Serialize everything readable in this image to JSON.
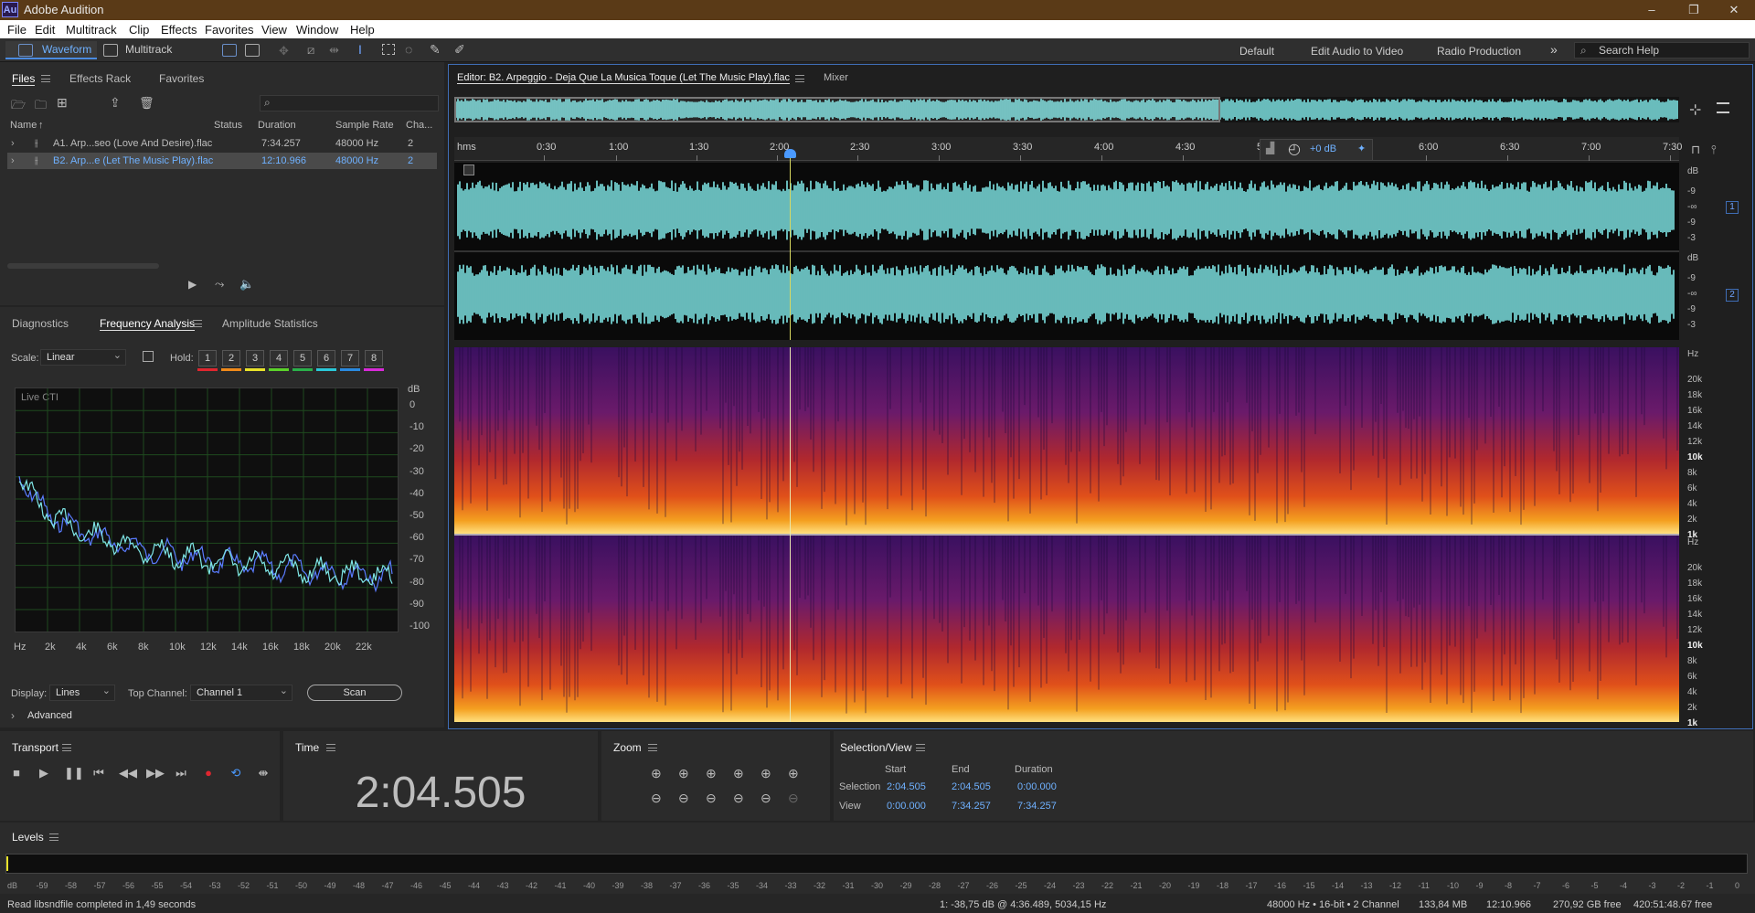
{
  "titlebar": {
    "app_logo": "Au",
    "title": "Adobe Audition",
    "minimize": "–",
    "maximize": "❐",
    "close": "✕"
  },
  "menu": [
    "File",
    "Edit",
    "Multitrack",
    "Clip",
    "Effects",
    "Favorites",
    "View",
    "Window",
    "Help"
  ],
  "toolbar": {
    "waveform": "Waveform",
    "multitrack": "Multitrack",
    "workspaces": [
      "Default",
      "Edit Audio to Video",
      "Radio Production"
    ],
    "more": "»",
    "search_placeholder": "Search Help"
  },
  "files": {
    "tabs": [
      "Files",
      "Effects Rack",
      "Favorites"
    ],
    "columns": [
      "Name",
      "Status",
      "Duration",
      "Sample Rate",
      "Cha..."
    ],
    "rows": [
      {
        "name": "A1. Arp...seo (Love And Desire).flac",
        "duration": "7:34.257",
        "rate": "48000 Hz",
        "ch": "2"
      },
      {
        "name": "B2. Arp...e (Let The Music Play).flac",
        "duration": "12:10.966",
        "rate": "48000 Hz",
        "ch": "2"
      }
    ]
  },
  "freq": {
    "tabs": [
      "Diagnostics",
      "Frequency Analysis",
      "Amplitude Statistics"
    ],
    "scale_label": "Scale:",
    "scale_value": "Linear",
    "hold_label": "Hold:",
    "holds": [
      "1",
      "2",
      "3",
      "4",
      "5",
      "6",
      "7",
      "8"
    ],
    "hold_colors": [
      "#e0262f",
      "#f08a1a",
      "#e8e22a",
      "#5bd22a",
      "#2ab04a",
      "#2ac8d8",
      "#2a8ae0",
      "#d82ad8"
    ],
    "live_label": "Live CTI",
    "db_unit": "dB",
    "db_ticks": [
      "0",
      "-10",
      "-20",
      "-30",
      "-40",
      "-50",
      "-60",
      "-70",
      "-80",
      "-90",
      "-100"
    ],
    "hz_ticks": [
      "Hz",
      "2k",
      "4k",
      "6k",
      "8k",
      "10k",
      "12k",
      "14k",
      "16k",
      "18k",
      "20k",
      "22k"
    ],
    "display_label": "Display:",
    "display_value": "Lines",
    "topch_label": "Top Channel:",
    "topch_value": "Channel 1",
    "scan": "Scan",
    "advanced": "Advanced"
  },
  "editor": {
    "tab": "Editor: B2. Arpeggio - Deja Que La Musica Toque (Let The Music Play).flac",
    "mixer": "Mixer",
    "ruler_unit": "hms",
    "ruler": [
      "0:30",
      "1:00",
      "1:30",
      "2:00",
      "2:30",
      "3:00",
      "3:30",
      "4:00",
      "4:30",
      "5",
      "6:00",
      "6:30",
      "7:00",
      "7:30"
    ],
    "gain": "+0 dB",
    "ch_db_unit": "dB",
    "ch_db": [
      "-9",
      "-∞",
      "-9",
      "-3"
    ],
    "hz_unit": "Hz",
    "hz_ticks": [
      "20k",
      "18k",
      "16k",
      "14k",
      "12k",
      "10k",
      "8k",
      "6k",
      "4k",
      "2k",
      "1k"
    ],
    "ch1": "1",
    "ch2": "2",
    "waveform_color": "#7fe6e6"
  },
  "transport": {
    "title": "Transport"
  },
  "time": {
    "title": "Time",
    "value": "2:04.505"
  },
  "zoom": {
    "title": "Zoom"
  },
  "selview": {
    "title": "Selection/View",
    "headers": [
      "Start",
      "End",
      "Duration"
    ],
    "selection_label": "Selection",
    "selection": [
      "2:04.505",
      "2:04.505",
      "0:00.000"
    ],
    "view_label": "View",
    "view": [
      "0:00.000",
      "7:34.257",
      "7:34.257"
    ]
  },
  "levels": {
    "title": "Levels",
    "ticks": [
      "dB",
      "-59",
      "-58",
      "-57",
      "-56",
      "-55",
      "-54",
      "-53",
      "-52",
      "-51",
      "-50",
      "-49",
      "-48",
      "-47",
      "-46",
      "-45",
      "-44",
      "-43",
      "-42",
      "-41",
      "-40",
      "-39",
      "-38",
      "-37",
      "-36",
      "-35",
      "-34",
      "-33",
      "-32",
      "-31",
      "-30",
      "-29",
      "-28",
      "-27",
      "-26",
      "-25",
      "-24",
      "-23",
      "-22",
      "-21",
      "-20",
      "-19",
      "-18",
      "-17",
      "-16",
      "-15",
      "-14",
      "-13",
      "-12",
      "-11",
      "-10",
      "-9",
      "-8",
      "-7",
      "-6",
      "-5",
      "-4",
      "-3",
      "-2",
      "-1",
      "0"
    ]
  },
  "status": {
    "left": "Read libsndfile completed in 1,49 seconds",
    "cursor": "1: -38,75 dB @ 4:36.489, 5034,15 Hz",
    "format": "48000 Hz • 16-bit • 2 Channel",
    "size": "133,84 MB",
    "duration": "12:10.966",
    "free": "270,92 GB free",
    "free_time": "420:51:48.67 free"
  }
}
